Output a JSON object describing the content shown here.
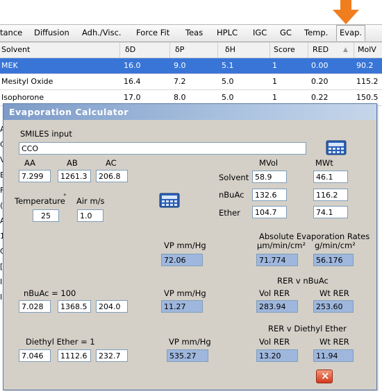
{
  "tabs": [
    "tance",
    "Diffusion",
    "Adh./Visc.",
    "Force Fit",
    "Teas",
    "HPLC",
    "IGC",
    "GC",
    "Temp.",
    "Evap."
  ],
  "table": {
    "headers": [
      "Solvent",
      "δD",
      "δP",
      "δH",
      "Score",
      "RED",
      "MolV"
    ],
    "sort_glyph": "▲",
    "rows": [
      [
        "MEK",
        "16.0",
        "9.0",
        "5.1",
        "1",
        "0.00",
        "90.2"
      ],
      [
        "Mesityl Oxide",
        "16.4",
        "7.2",
        "5.0",
        "1",
        "0.20",
        "115.2"
      ],
      [
        "Isophorone",
        "17.0",
        "8.0",
        "5.0",
        "1",
        "0.22",
        "150.5"
      ]
    ],
    "partial_left_letters": [
      "A",
      "C",
      "V",
      "E",
      "F",
      "(",
      "A",
      "1",
      "C",
      "[",
      "I",
      "I"
    ]
  },
  "dialog": {
    "title": "Evaporation Calculator",
    "smiles_label": "SMILES input",
    "smiles_value": "CCO",
    "antoine_headers": [
      "AA",
      "AB",
      "AC"
    ],
    "antoine_values": [
      "7.299",
      "1261.3",
      "206.8"
    ],
    "temperature_label": "Temperature",
    "degree_mark": "°",
    "air_label": "Air m/s",
    "temperature_value": "25",
    "air_value": "1.0",
    "mvol_label": "MVol",
    "mwt_label": "MWt",
    "solvent_label": "Solvent",
    "solvent_mvol": "58.9",
    "solvent_mwt": "46.1",
    "nbuac_label": "nBuAc",
    "nbuac_mvol": "132.6",
    "nbuac_mwt": "116.2",
    "ether_label": "Ether",
    "ether_mvol": "104.7",
    "ether_mwt": "74.1",
    "vp_label": "VP mm/Hg",
    "vp_value": "72.06",
    "abs_rates_label": "Absolute Evaporation Rates",
    "abs_units_vol": "μm/min/cm²",
    "abs_units_wt": "g/min/cm²",
    "abs_vol_value": "71.774",
    "abs_wt_value": "56.176",
    "nbuac_ref_label": "nBuAc = 100",
    "nbuac_antoine": [
      "7.028",
      "1368.5",
      "204.0"
    ],
    "nbuac_vp_label": "VP mm/Hg",
    "nbuac_vp_value": "11.27",
    "rer_nbuac_label": "RER v nBuAc",
    "vol_rer_label": "Vol RER",
    "wt_rer_label": "Wt RER",
    "rer_nbuac_vol": "283.94",
    "rer_nbuac_wt": "253.60",
    "ether_ref_label": "Diethyl Ether = 1",
    "ether_antoine": [
      "7.046",
      "1112.6",
      "232.7"
    ],
    "ether_vp_label": "VP mm/Hg",
    "ether_vp_value": "535.27",
    "rer_ether_label": "RER v Diethyl Ether",
    "vol_rer_label2": "Vol RER",
    "wt_rer_label2": "Wt RER",
    "rer_ether_vol": "13.20",
    "rer_ether_wt": "11.94"
  },
  "colors": {
    "selection": "#3875d7",
    "dialog_bg": "#d4d0c8",
    "result_box": "#9fb7dd",
    "arrow": "#f07d1e"
  },
  "icons": [
    "down-arrow-icon",
    "calculator-icon",
    "close-icon"
  ]
}
